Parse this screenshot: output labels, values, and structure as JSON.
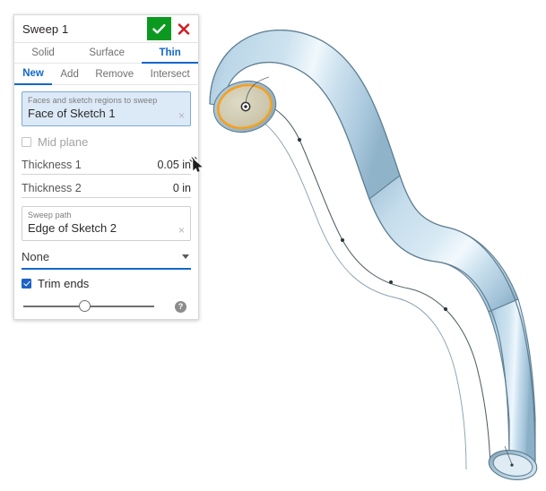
{
  "panel": {
    "title": "Sweep 1",
    "accept_icon": "checkmark-icon",
    "cancel_icon": "close-icon",
    "primary_tabs": [
      {
        "label": "Solid",
        "active": false
      },
      {
        "label": "Surface",
        "active": false
      },
      {
        "label": "Thin",
        "active": true
      }
    ],
    "secondary_tabs": [
      {
        "label": "New",
        "active": true
      },
      {
        "label": "Add",
        "active": false
      },
      {
        "label": "Remove",
        "active": false
      },
      {
        "label": "Intersect",
        "active": false
      }
    ],
    "faces_field": {
      "label": "Faces and sketch regions to sweep",
      "value": "Face of Sketch 1",
      "clear": "×"
    },
    "mid_plane": {
      "label": "Mid plane",
      "checked": false
    },
    "thickness_1": {
      "label": "Thickness 1",
      "value": "0.05 in"
    },
    "thickness_2": {
      "label": "Thickness 2",
      "value": "0 in"
    },
    "sweep_path_field": {
      "label": "Sweep path",
      "value": "Edge of Sketch 2",
      "clear": "×"
    },
    "profile_control": {
      "value": "None"
    },
    "trim_ends": {
      "label": "Trim ends",
      "checked": true
    },
    "opacity_slider": {
      "value": 45
    },
    "help": {
      "label": "?"
    }
  },
  "viewport": {
    "name": "3d-model-viewport",
    "model_name": "swept-thin-tube",
    "colors": {
      "tube_light": "#e8f2f9",
      "tube_mid": "#b4d2e6",
      "tube_dark": "#8cb0c6",
      "tube_edge": "#5f7e92",
      "cap_face": "#cfcab0",
      "cap_highlight": "#f5a01e",
      "background": "#ffffff"
    }
  }
}
